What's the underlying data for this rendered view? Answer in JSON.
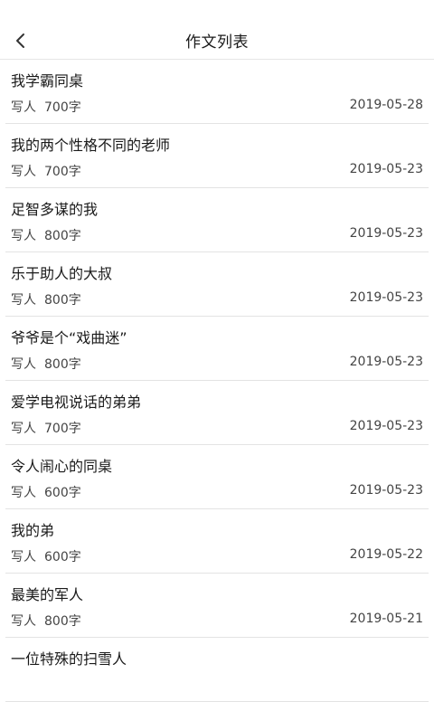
{
  "header": {
    "title": "作文列表",
    "back_icon": "chevron-left-icon"
  },
  "essays": [
    {
      "title": "我学霸同桌",
      "category": "写人",
      "words": "700字",
      "date": "2019-05-28"
    },
    {
      "title": "我的两个性格不同的老师",
      "category": "写人",
      "words": "700字",
      "date": "2019-05-23"
    },
    {
      "title": "足智多谋的我",
      "category": "写人",
      "words": "800字",
      "date": "2019-05-23"
    },
    {
      "title": "乐于助人的大叔",
      "category": "写人",
      "words": "800字",
      "date": "2019-05-23"
    },
    {
      "title": "爷爷是个“戏曲迷”",
      "category": "写人",
      "words": "800字",
      "date": "2019-05-23"
    },
    {
      "title": "爱学电视说话的弟弟",
      "category": "写人",
      "words": "700字",
      "date": "2019-05-23"
    },
    {
      "title": "令人闹心的同桌",
      "category": "写人",
      "words": "600字",
      "date": "2019-05-23"
    },
    {
      "title": "我的弟",
      "category": "写人",
      "words": "600字",
      "date": "2019-05-22"
    },
    {
      "title": "最美的军人",
      "category": "写人",
      "words": "800字",
      "date": "2019-05-21"
    },
    {
      "title": "一位特殊的扫雪人"
    }
  ]
}
